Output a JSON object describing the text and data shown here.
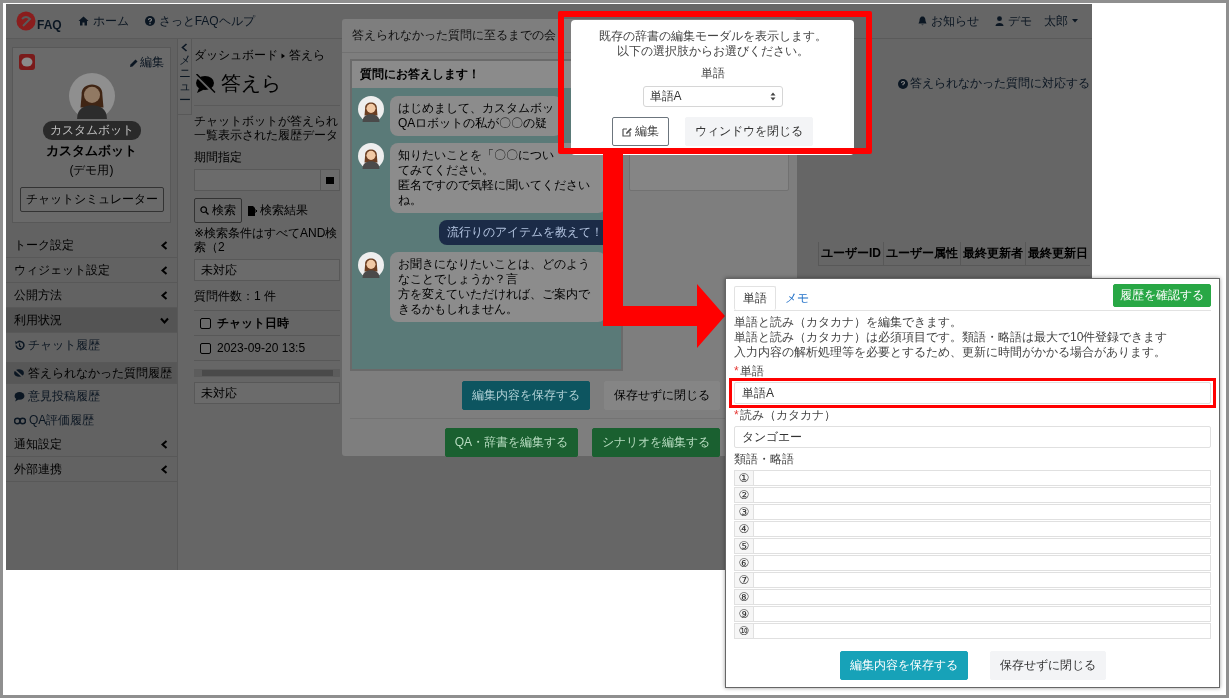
{
  "header": {
    "logo_text": "FAQ",
    "nav": [
      "ホーム",
      "さっとFAQヘルプ"
    ],
    "notice": "お知らせ",
    "user": "デモ　太郎"
  },
  "sidebar": {
    "profile": {
      "edit": "編集",
      "badge": "カスタムボット",
      "name": "カスタムボット",
      "note": "(デモ用)",
      "simulator": "チャットシミュレーター"
    },
    "items": [
      {
        "label": "トーク設定",
        "expanded": false
      },
      {
        "label": "ウィジェット設定",
        "expanded": false
      },
      {
        "label": "公開方法",
        "expanded": false
      },
      {
        "label": "利用状況",
        "expanded": true,
        "children": [
          {
            "label": "チャット履歴",
            "selected": false
          },
          {
            "label": "答えられなかった質問履歴",
            "selected": true
          },
          {
            "label": "意見投稿履歴",
            "selected": false
          },
          {
            "label": "QA評価履歴",
            "selected": false
          }
        ]
      },
      {
        "label": "通知設定",
        "expanded": false
      },
      {
        "label": "外部連携",
        "expanded": false
      }
    ]
  },
  "menu_toggle": "メニュー",
  "main": {
    "breadcrumb": [
      "ダッシュボード",
      "答えら"
    ],
    "title": "答えら",
    "description": [
      "チャットボットが答えられ",
      "一覧表示された履歴データ"
    ],
    "period_label": "期間指定",
    "search_button": "検索",
    "export_button": "検索結果",
    "note": "※検索条件はすべてAND検索（2",
    "status_select": "未対応",
    "count": "質問件数：1 件",
    "table": {
      "header_checked": false,
      "columns": [
        "チャット日時"
      ],
      "rows": [
        {
          "checked": false,
          "date": "2023-09-20 13:5"
        }
      ]
    },
    "status_select_2": "未対応",
    "help_link": "答えられなかった質問に対応する",
    "right_columns": [
      "ユーザーID",
      "ユーザー属性",
      "最終更新者",
      "最終更新日"
    ]
  },
  "modal": {
    "title": "答えられなかった質問に至るまでの会",
    "chat": {
      "header": "質問にお答えします！",
      "messages": [
        {
          "kind": "bot",
          "lines": [
            "はじめまして、カスタムボッ",
            "QAロボットの私が〇〇の疑"
          ]
        },
        {
          "kind": "bot",
          "lines": [
            "知りたいことを「〇〇につい",
            "てみてください。",
            "匿名ですので気軽に聞いてくださいね。"
          ]
        },
        {
          "kind": "user",
          "lines": [
            "流行りのアイテムを教えて！"
          ]
        },
        {
          "kind": "bot",
          "lines": [
            "お聞きになりたいことは、どのようなことでしょうか？言",
            "方を変えていただければ、ご案内できるかもしれません。"
          ]
        }
      ]
    },
    "buttons": [
      {
        "label": "編集内容を保存する",
        "kind": "info"
      },
      {
        "label": "保存せずに閉じる",
        "kind": "light"
      }
    ],
    "footer_buttons": [
      {
        "label": "QA・辞書を編集する",
        "kind": "success"
      },
      {
        "label": "シナリオを編集する",
        "kind": "success"
      }
    ]
  },
  "dialog": {
    "message": [
      "既存の辞書の編集モーダルを表示します。",
      "以下の選択肢からお選びください。"
    ],
    "label": "単語",
    "select_value": "単語A",
    "buttons": [
      {
        "label": "編集",
        "kind": "outline"
      },
      {
        "label": "ウィンドウを閉じる",
        "kind": "light"
      }
    ]
  },
  "panel": {
    "tabs": [
      {
        "label": "単語",
        "selected": true
      },
      {
        "label": "メモ",
        "selected": false
      }
    ],
    "history_button": "履歴を確認する",
    "notes": [
      "単語と読み（カタカナ）を編集できます。",
      "単語と読み（カタカナ）は必須項目です。類語・略語は最大で10件登録できます",
      "入力内容の解析処理等を必要とするため、更新に時間がかかる場合があります。"
    ],
    "fields": [
      {
        "required_mark": "*",
        "label": "単語",
        "value": "単語A",
        "highlighted": true
      },
      {
        "required_mark": "*",
        "label": "読み（カタカナ）",
        "value": "タンゴエー",
        "highlighted": false
      }
    ],
    "synonyms_label": "類語・略語",
    "synonym_slots": [
      "①",
      "②",
      "③",
      "④",
      "⑤",
      "⑥",
      "⑦",
      "⑧",
      "⑨",
      "⑩"
    ],
    "buttons": [
      {
        "label": "編集内容を保存する",
        "kind": "info"
      },
      {
        "label": "保存せずに閉じる",
        "kind": "light"
      }
    ]
  }
}
